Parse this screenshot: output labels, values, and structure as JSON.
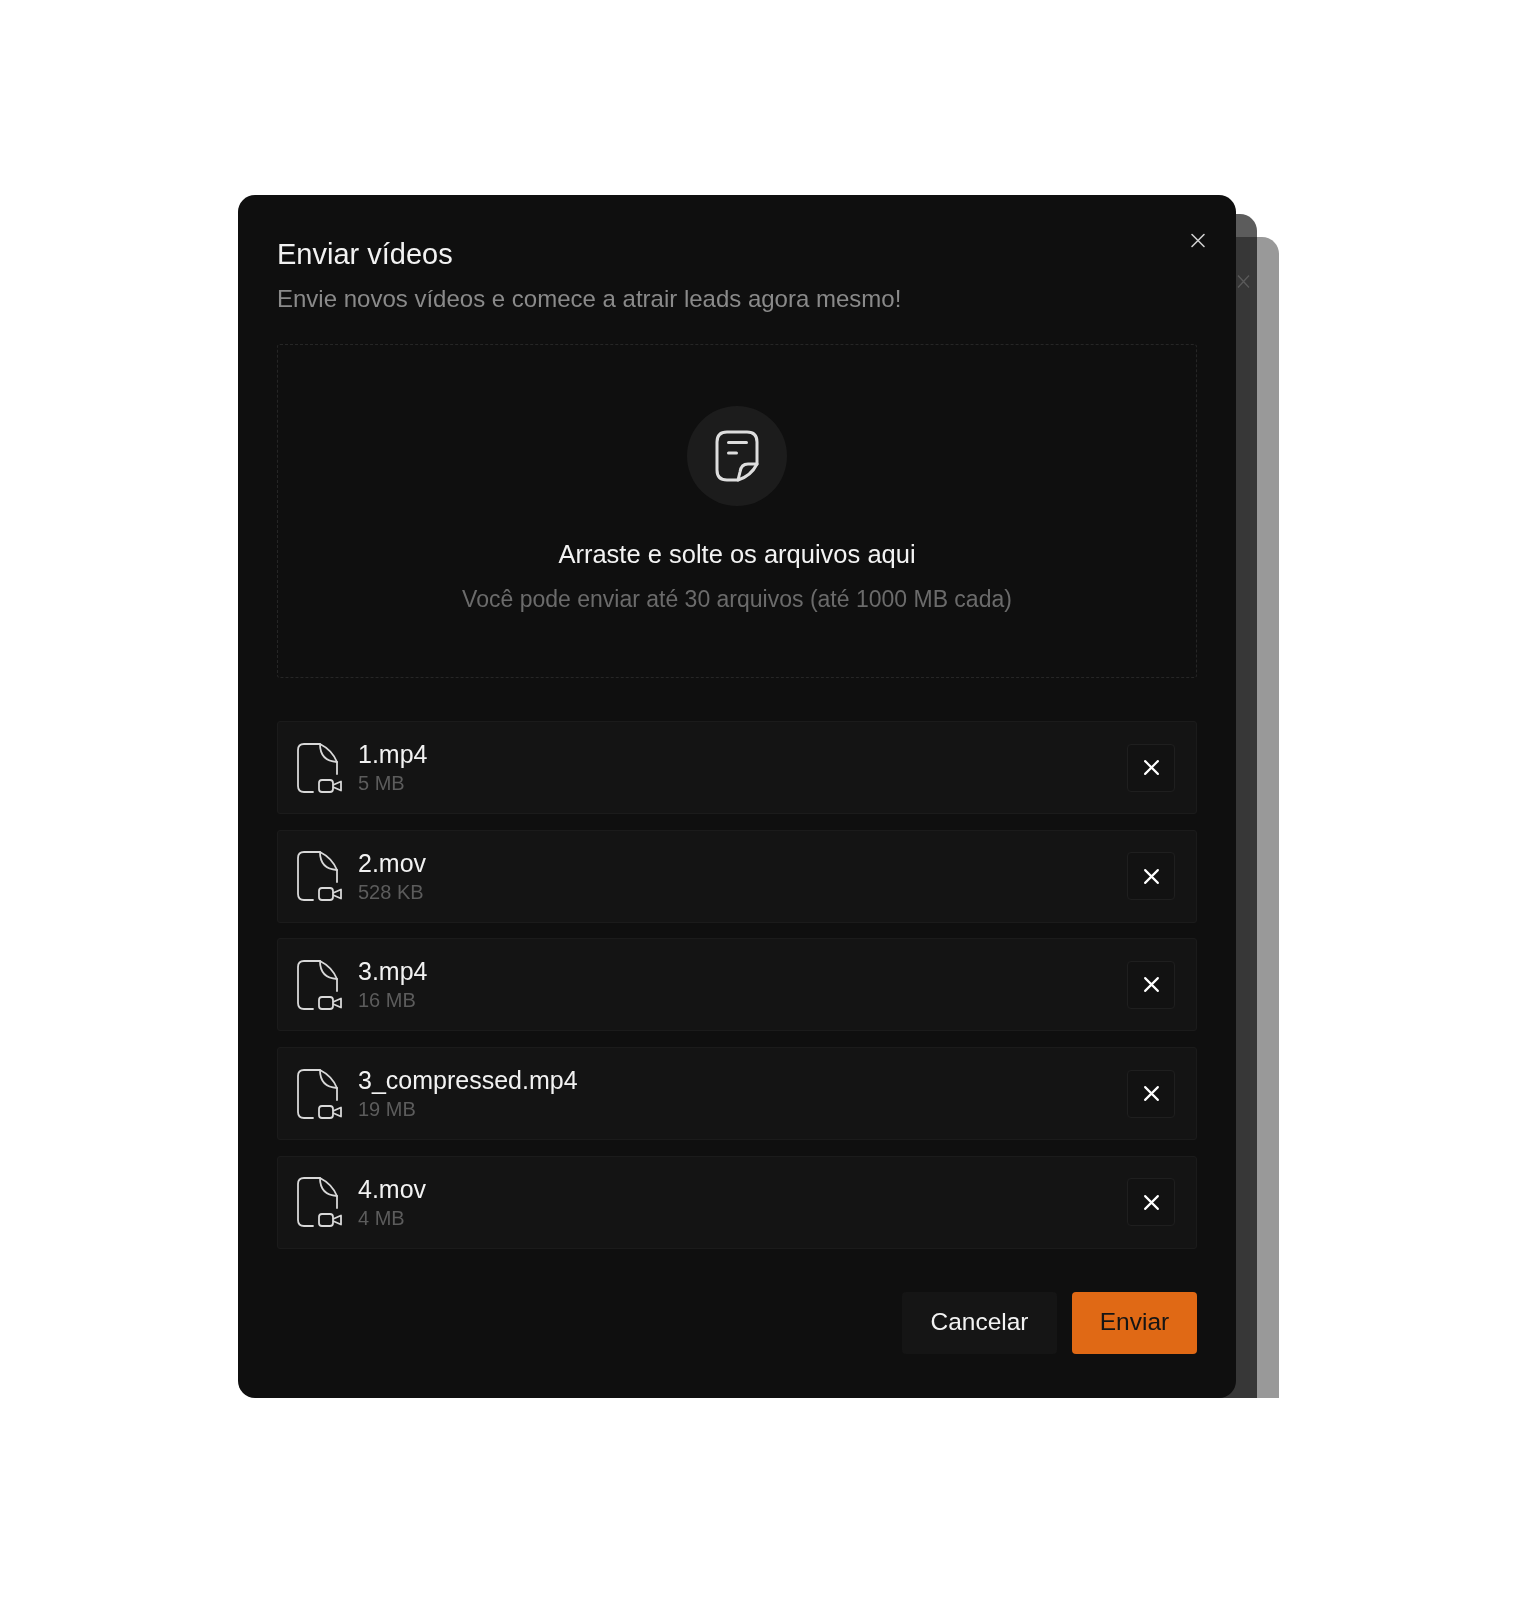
{
  "dialog": {
    "title": "Enviar vídeos",
    "subtitle": "Envie novos vídeos e comece a atrair leads agora mesmo!"
  },
  "dropzone": {
    "heading": "Arraste e solte os arquivos aqui",
    "hint": "Você pode enviar até 30 arquivos (até 1000 MB cada)"
  },
  "files": [
    {
      "name": "1.mp4",
      "size": "5 MB"
    },
    {
      "name": "2.mov",
      "size": "528 KB"
    },
    {
      "name": "3.mp4",
      "size": "16 MB"
    },
    {
      "name": "3_compressed.mp4",
      "size": "19 MB"
    },
    {
      "name": "4.mov",
      "size": "4 MB"
    }
  ],
  "buttons": [
    {
      "label": "Cancelar",
      "kind": "secondary"
    },
    {
      "label": "Enviar",
      "kind": "primary"
    }
  ]
}
